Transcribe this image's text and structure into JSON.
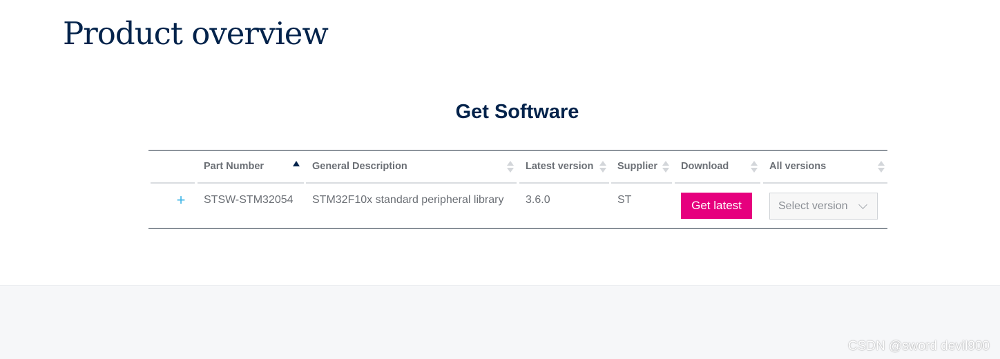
{
  "page": {
    "title": "Product overview"
  },
  "section": {
    "title": "Get Software"
  },
  "table": {
    "columns": [
      "",
      "Part Number",
      "General Description",
      "Latest version",
      "Supplier",
      "Download",
      "All versions"
    ],
    "rows": [
      {
        "expand_symbol": "+",
        "part_number": "STSW-STM32054",
        "description": "STM32F10x standard peripheral library",
        "latest_version": "3.6.0",
        "supplier": "ST",
        "download_label": "Get latest",
        "versions_placeholder": "Select version"
      }
    ]
  },
  "colors": {
    "accent": "#e6007e",
    "title": "#03234b",
    "expand": "#3cb4e6"
  },
  "watermark": "CSDN @sword devil900"
}
